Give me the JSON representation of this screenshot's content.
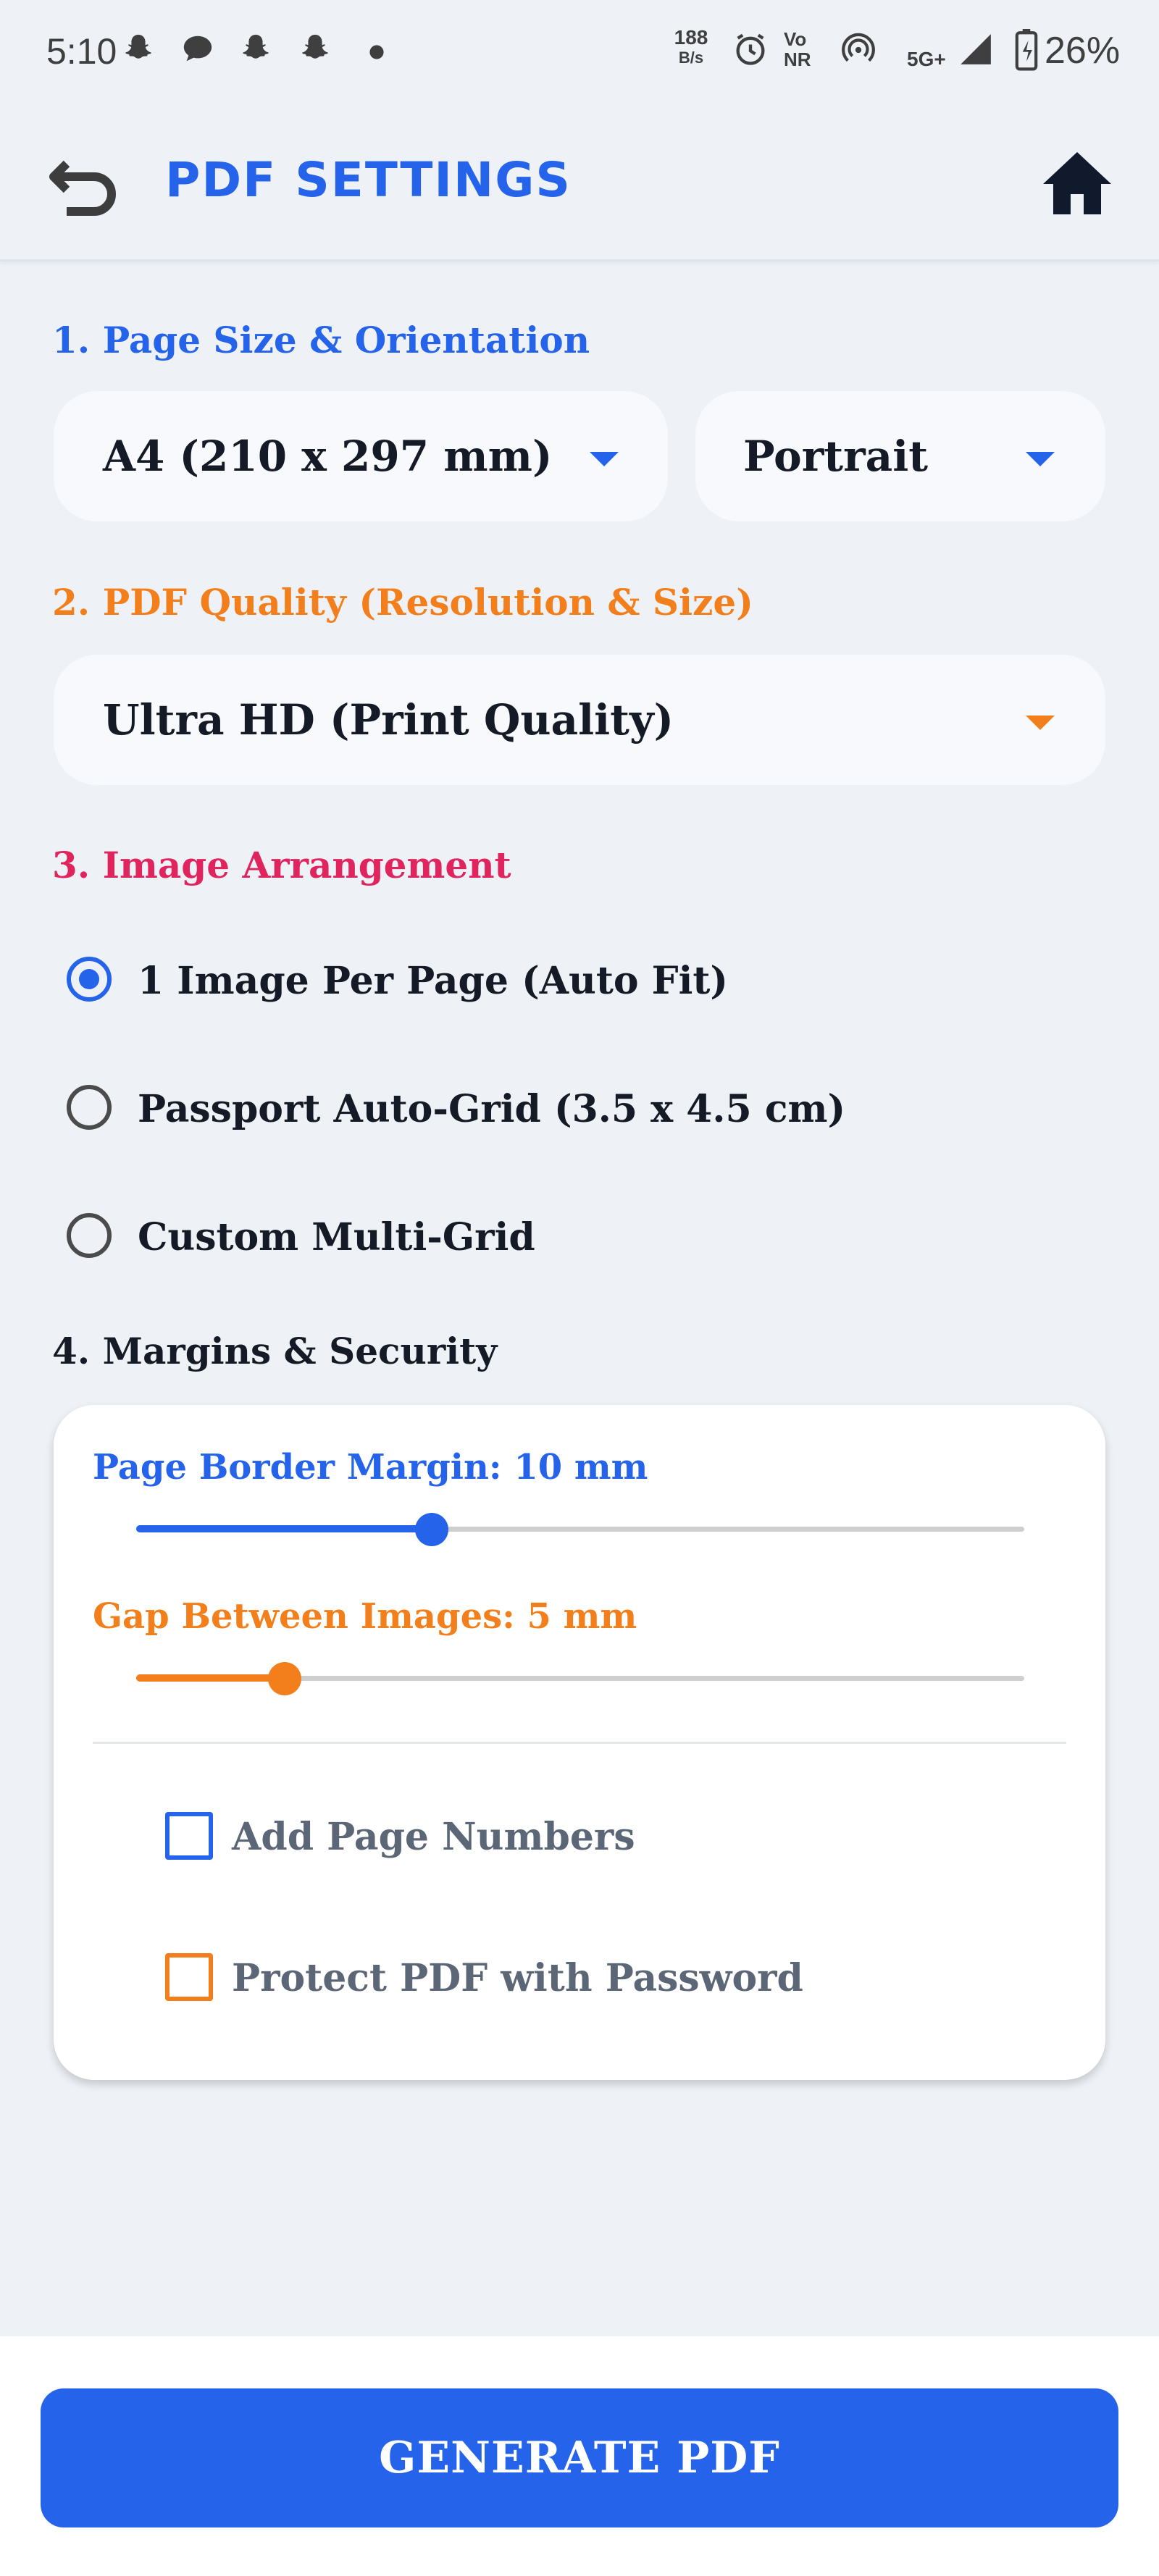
{
  "status_bar": {
    "time": "5:10",
    "net_speed_value": "188",
    "net_speed_unit": "B/s",
    "volte_top": "Vo",
    "volte_bottom": "NR",
    "network": "5G+",
    "battery": "26%"
  },
  "app_bar": {
    "title": "PDF SETTINGS",
    "back_icon": "back-arrow-icon",
    "home_icon": "home-icon"
  },
  "sections": {
    "page_size": {
      "label": "1. Page Size & Orientation",
      "color": "#2563eb",
      "size_value": "A4 (210 x 297 mm)",
      "orientation_value": "Portrait"
    },
    "quality": {
      "label": "2. PDF Quality (Resolution & Size)",
      "color": "#f27f1b",
      "value": "Ultra HD (Print Quality)"
    },
    "arrangement": {
      "label": "3. Image Arrangement",
      "color": "#e0245e",
      "options": [
        {
          "label": "1 Image Per Page (Auto Fit)",
          "selected": true
        },
        {
          "label": "Passport Auto-Grid (3.5 x 4.5 cm)",
          "selected": false
        },
        {
          "label": "Custom Multi-Grid",
          "selected": false
        }
      ]
    },
    "margins": {
      "label": "4. Margins & Security",
      "color": "#141a26",
      "border_margin_label": "Page Border Margin: 10 mm",
      "border_margin_fraction": 0.333,
      "border_margin_color": "#2563eb",
      "gap_label": "Gap Between Images: 5 mm",
      "gap_fraction": 0.167,
      "gap_color": "#f27f1b",
      "add_page_numbers": {
        "label": "Add Page Numbers",
        "checked": false,
        "color": "#2563eb"
      },
      "protect_password": {
        "label": "Protect PDF with Password",
        "checked": false,
        "color": "#f27f1b"
      }
    }
  },
  "footer": {
    "generate_label": "GENERATE PDF",
    "generate_color": "#2563eb"
  }
}
